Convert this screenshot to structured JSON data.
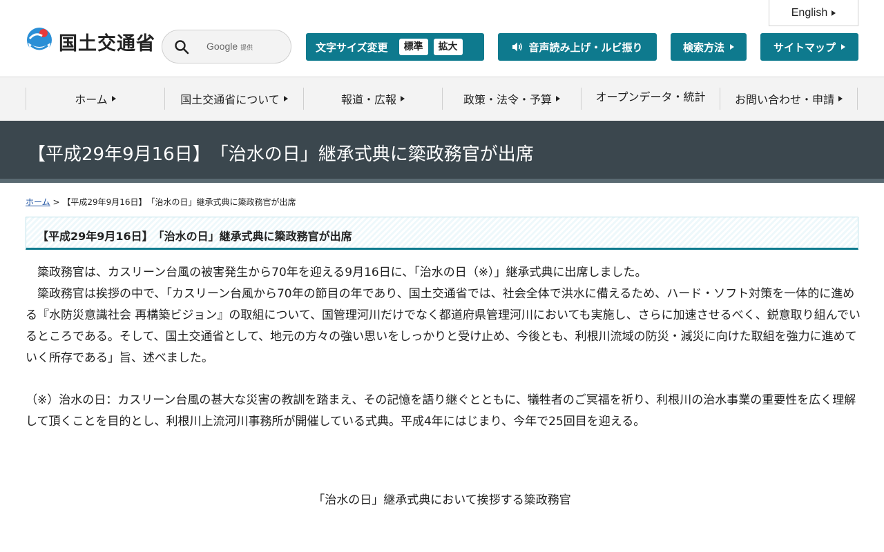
{
  "header": {
    "logo_text": "国土交通省",
    "search": {
      "placeholder": "",
      "google_label": "Google",
      "google_sub": "提供"
    },
    "english_label": "English",
    "font_size": {
      "label": "文字サイズ変更",
      "standard": "標準",
      "large": "拡大"
    },
    "voice_label": "音声読み上げ・ルビ振り",
    "search_method_label": "検索方法",
    "sitemap_label": "サイトマップ"
  },
  "nav": {
    "items": [
      {
        "label": "ホーム"
      },
      {
        "label": "国土交通省について"
      },
      {
        "label": "報道・広報"
      },
      {
        "label": "政策・法令・予算"
      },
      {
        "label": "オープンデータ・統計"
      },
      {
        "label": "お問い合わせ・申請"
      }
    ]
  },
  "page": {
    "title": "【平成29年9月16日】　「治水の日」継承式典に簗政務官が出席",
    "breadcrumb": {
      "home": "ホーム",
      "separator": ">",
      "current": "【平成29年9月16日】　「治水の日」継承式典に簗政務官が出席"
    },
    "section_heading": "【平成29年9月16日】　「治水の日」継承式典に簗政務官が出席",
    "paragraph1": "　簗政務官は、カスリーン台風の被害発生から70年を迎える9月16日に、「治水の日（※）」継承式典に出席しました。\n　簗政務官は挨拶の中で、「カスリーン台風から70年の節目の年であり、国土交通省では、社会全体で洪水に備えるため、ハード・ソフト対策を一体的に進める『水防災意識社会 再構築ビジョン』の取組について、国管理河川だけでなく都道府県管理河川においても実施し、さらに加速させるべく、鋭意取り組んでいるところである。そして、国土交通省として、地元の方々の強い思いをしっかりと受け止め、今後とも、利根川流域の防災・減災に向けた取組を強力に進めていく所存である」旨、述べました。",
    "paragraph2": "（※）治水の日：カスリーン台風の甚大な災害の教訓を踏まえ、その記憶を語り継ぐとともに、犠牲者のご冥福を祈り、利根川の治水事業の重要性を広く理解して頂くことを目的とし、利根川上流河川事務所が開催している式典。平成4年にはじまり、今年で25回目を迎える。",
    "caption": "「治水の日」継承式典において挨拶する簗政務官"
  },
  "colors": {
    "accent": "#0e7a8e",
    "title_band": "#3b474e",
    "link": "#1a4fa0"
  }
}
